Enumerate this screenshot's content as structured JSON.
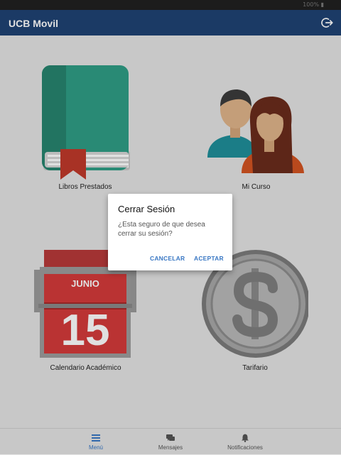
{
  "status_bar": {
    "battery": "100% ▮"
  },
  "app_bar": {
    "title": "UCB Movil"
  },
  "tiles": [
    {
      "label": "Libros Prestados"
    },
    {
      "label": "Mi Curso"
    },
    {
      "label": "Calendario Académico",
      "calendar_month": "JUNIO",
      "calendar_day": "15"
    },
    {
      "label": "Tarifario"
    }
  ],
  "dialog": {
    "title": "Cerrar Sesión",
    "message": "¿Esta seguro de que desea cerrar su sesión?",
    "cancel_label": "CANCELAR",
    "accept_label": "ACEPTAR"
  },
  "tabs": [
    {
      "label": "Menú",
      "icon": "menu-icon",
      "active": true
    },
    {
      "label": "Mensajes",
      "icon": "chat-icon",
      "active": false
    },
    {
      "label": "Notificaciones",
      "icon": "bell-icon",
      "active": false
    }
  ],
  "colors": {
    "app_bar": "#1f4374",
    "accent": "#3a78c4",
    "book": "#2f9e86",
    "bookmark": "#c0392b"
  }
}
